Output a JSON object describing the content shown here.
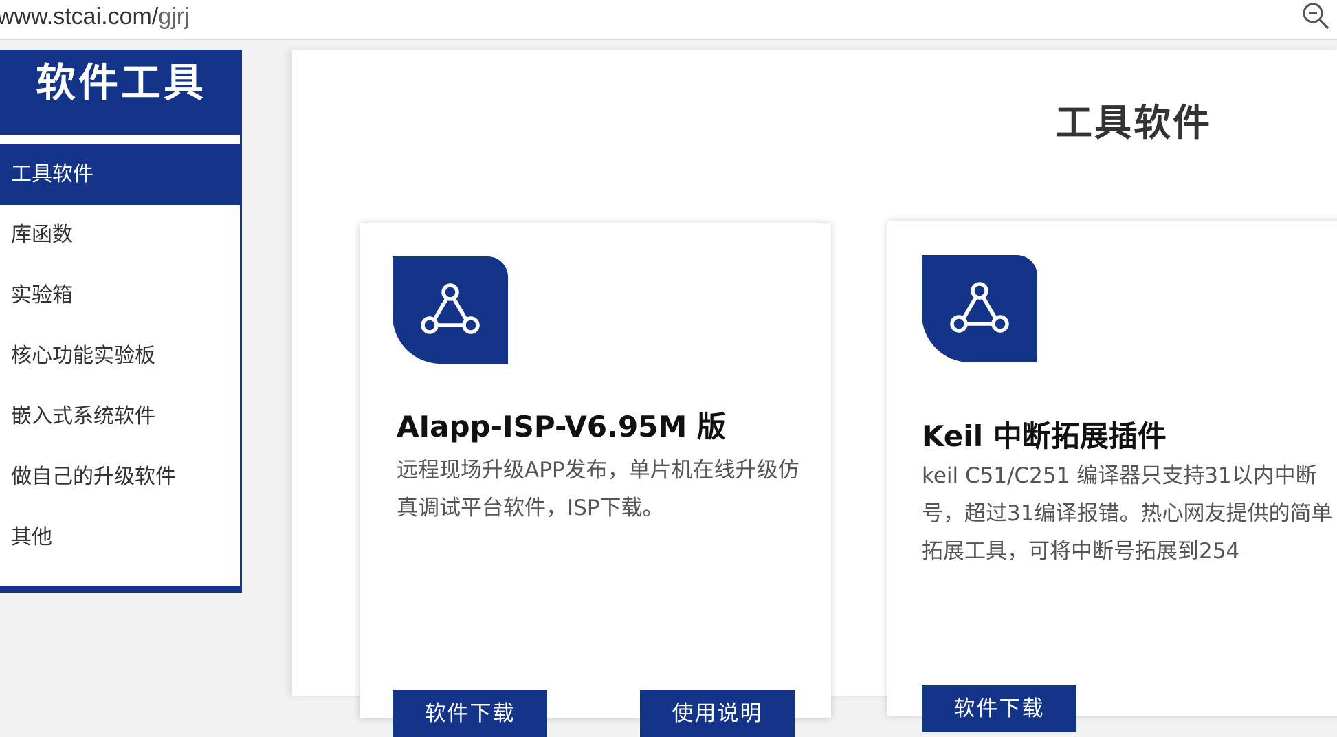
{
  "browser": {
    "url_host": "www.stcai.com/",
    "url_path": "gjrj"
  },
  "sidebar": {
    "title": "软件工具",
    "items": [
      {
        "label": "工具软件",
        "active": true
      },
      {
        "label": "库函数"
      },
      {
        "label": "实验箱"
      },
      {
        "label": "核心功能实验板"
      },
      {
        "label": "嵌入式系统软件"
      },
      {
        "label": "做自己的升级软件"
      },
      {
        "label": "其他"
      }
    ]
  },
  "main": {
    "title": "工具软件",
    "cards": [
      {
        "icon": "share-nodes-icon",
        "title": "AIapp-ISP-V6.95M 版",
        "desc": "远程现场升级APP发布，单片机在线升级仿真调试平台软件，ISP下载。",
        "download_label": "软件下载",
        "manual_label": "使用说明"
      },
      {
        "icon": "share-nodes-icon",
        "title": "Keil 中断拓展插件",
        "desc": "keil C51/C251 编译器只支持31以内中断号，超过31编译报错。热心网友提供的简单拓展工具，可将中断号拓展到254",
        "download_label": "软件下载"
      }
    ]
  },
  "colors": {
    "brand": "#14348a"
  }
}
